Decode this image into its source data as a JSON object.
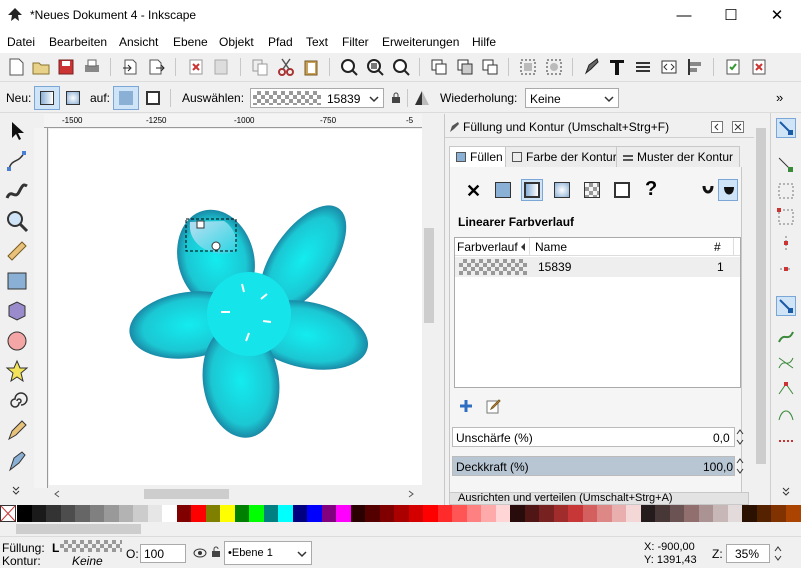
{
  "window": {
    "title": "*Neues Dokument 4 - Inkscape",
    "minimize": "—",
    "maximize": "☐",
    "close": "✕"
  },
  "menu": [
    "Datei",
    "Bearbeiten",
    "Ansicht",
    "Ebene",
    "Objekt",
    "Pfad",
    "Text",
    "Filter",
    "Erweiterungen",
    "Hilfe"
  ],
  "toolbar2": {
    "neu_label": "Neu:",
    "auf_label": "auf:",
    "auswaehlen_label": "Auswählen:",
    "gradient_name": "15839",
    "wiederholung_label": "Wiederholung:",
    "wiederholung_value": "Keine",
    "overflow": "»"
  },
  "rulers": {
    "h_ticks": [
      "-1500",
      "-1250",
      "-1000",
      "-750",
      "-5"
    ],
    "v_ticks": [
      "1",
      "0",
      "0",
      "0",
      "5",
      "0",
      "0"
    ]
  },
  "panel": {
    "title": "Füllung und Kontur (Umschalt+Strg+F)",
    "tabs": [
      "Füllen",
      "Farbe der Kontur",
      "Muster der Kontur"
    ],
    "fill_type_title": "Linearer Farbverlauf",
    "x_symbol": "✕",
    "question_symbol": "?",
    "list_headers": {
      "gradient": "Farbverlauf",
      "name": "Name",
      "count": "#"
    },
    "list_row": {
      "name": "15839",
      "count": "1"
    },
    "blur_label": "Unschärfe (%)",
    "blur_value": "0,0",
    "opacity_label": "Deckkraft (%)",
    "opacity_value": "100,0",
    "next_panel": "Ausrichten und verteilen (Umschalt+Strg+A)"
  },
  "status": {
    "fill_label": "Füllung:",
    "stroke_label": "Kontur:",
    "stroke_value": "Keine",
    "fill_swatch_letter": "L",
    "opacity_label": "O:",
    "opacity_value": "100",
    "layer": "•Ebene 1",
    "x_coord": "X: -900,00",
    "y_coord": "Y: 1391,43",
    "zoom_label": "Z:",
    "zoom_value": "35%"
  },
  "palette_colors": [
    "#000000",
    "#1a1a1a",
    "#333333",
    "#4d4d4d",
    "#666666",
    "#808080",
    "#999999",
    "#b3b3b3",
    "#cccccc",
    "#e6e6e6",
    "#ffffff",
    "#800000",
    "#ff0000",
    "#808000",
    "#ffff00",
    "#008000",
    "#00ff00",
    "#008080",
    "#00ffff",
    "#000080",
    "#0000ff",
    "#800080",
    "#ff00ff",
    "#2b0000",
    "#550000",
    "#800000",
    "#aa0000",
    "#d40000",
    "#ff0000",
    "#ff2a2a",
    "#ff5555",
    "#ff8080",
    "#ffaaaa",
    "#ffd5d5",
    "#280b0b",
    "#501616",
    "#782121",
    "#a02c2c",
    "#c83737",
    "#d35f5f",
    "#de8787",
    "#e9afaf",
    "#f4d7d7",
    "#241c1c",
    "#483737",
    "#6c5353",
    "#916f6f",
    "#ac9393",
    "#c8b7b7",
    "#e3dbdb",
    "#2b1100",
    "#552200",
    "#803300",
    "#aa4400"
  ]
}
